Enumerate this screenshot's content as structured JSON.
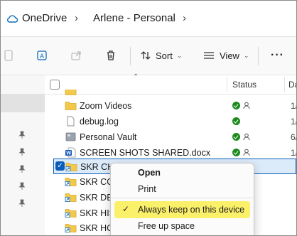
{
  "breadcrumb": {
    "root": "OneDrive",
    "current": "Arlene - Personal"
  },
  "toolbar": {
    "sort_label": "Sort",
    "view_label": "View",
    "more_label": "···"
  },
  "columns": {
    "status": "Status",
    "date": "Da"
  },
  "files": [
    {
      "name": "Zoom Videos",
      "icon": "folder-icon",
      "status": "synced-shared",
      "date": "1/"
    },
    {
      "name": "debug.log",
      "icon": "file-icon",
      "status": "synced",
      "date": "1/"
    },
    {
      "name": "Personal Vault",
      "icon": "vault-icon",
      "status": "synced-shared",
      "date": "6/"
    },
    {
      "name": "SCREEN SHOTS SHARED.docx",
      "icon": "word-icon",
      "status": "synced-shared",
      "date": "1/"
    },
    {
      "name": "SKR CHA",
      "icon": "folder-shortcut-icon",
      "status": "",
      "date": ""
    },
    {
      "name": "SKR COR",
      "icon": "folder-shortcut-icon",
      "status": "",
      "date": ""
    },
    {
      "name": "SKR DEV",
      "icon": "folder-shortcut-icon",
      "status": "",
      "date": ""
    },
    {
      "name": "SKR HIST",
      "icon": "folder-shortcut-icon",
      "status": "",
      "date": ""
    },
    {
      "name": "SKR HOM",
      "icon": "folder-shortcut-icon",
      "status": "",
      "date": ""
    }
  ],
  "context_menu": {
    "open": "Open",
    "print": "Print",
    "always_keep": "Always keep on this device",
    "free_up": "Free up space"
  }
}
